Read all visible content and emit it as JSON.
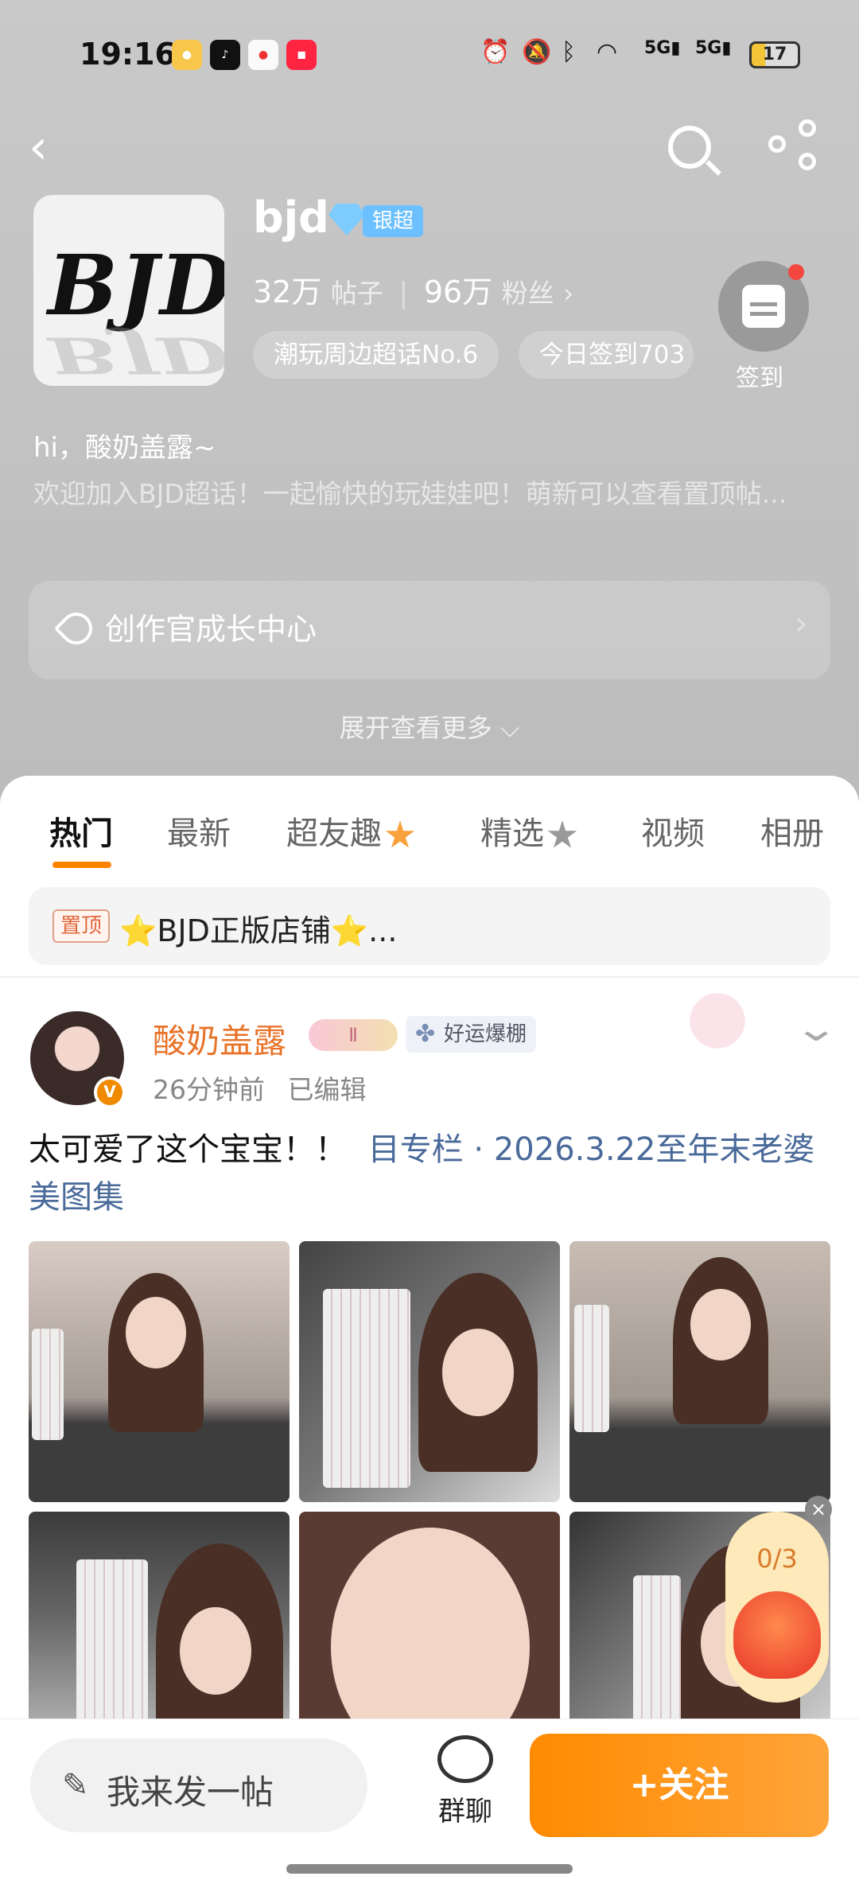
{
  "status_bar": {
    "time": "19:16",
    "apps": [
      "weibo",
      "douyin",
      "weibo-alt",
      "xiaohongshu"
    ],
    "network": "5G",
    "battery": "17"
  },
  "topic": {
    "name": "bjd",
    "avatar_text": "BJD",
    "badge": "银超",
    "posts_count": "32万",
    "posts_label": "帖子",
    "fans_count": "96万",
    "fans_label": "粉丝",
    "chips": [
      "潮玩周边超话No.6",
      "今日签到703"
    ],
    "signin_label": "签到",
    "greeting": "hi，酸奶盖露~",
    "description": "欢迎加入BJD超话！一起愉快的玩娃娃吧！萌新可以查看置顶帖...",
    "growth_center": "创作官成长中心",
    "expand_more": "展开查看更多"
  },
  "tabs": [
    {
      "label": "热门"
    },
    {
      "label": "最新"
    },
    {
      "label": "超友趣"
    },
    {
      "label": "精选"
    },
    {
      "label": "视频"
    },
    {
      "label": "相册"
    }
  ],
  "pinned": {
    "tag": "置顶",
    "text": "⭐BJD正版店铺⭐..."
  },
  "post": {
    "username": "酸奶盖露",
    "level_badge": "Ⅱ",
    "luck_badge": "好运爆棚",
    "time": "26分钟前",
    "edited": "已编辑",
    "text": "太可爱了这个宝宝！！",
    "column_link": "目专栏 · 2026.3.22至年末老婆美图集",
    "image_count": 6
  },
  "float_widget": {
    "progress": "0/3"
  },
  "bottom_bar": {
    "post_placeholder": "我来发一帖",
    "group_chat": "群聊",
    "follow": "+关注"
  },
  "colors": {
    "accent": "#ff8200",
    "username": "#e8742a",
    "link": "#4a6a9a",
    "header_bg": "#c4c4c4"
  },
  "icons": [
    "back-icon",
    "search-icon",
    "share-icon",
    "calendar-icon",
    "pen-icon",
    "group-chat-icon",
    "chevron-right-icon",
    "chevron-down-icon",
    "close-icon"
  ]
}
